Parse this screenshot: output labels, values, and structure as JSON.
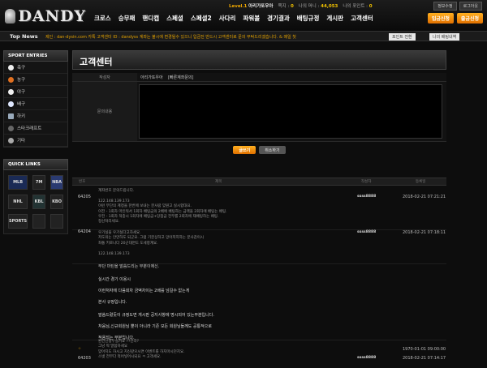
{
  "header": {
    "logo_text": "DANDY",
    "level": "Level.1",
    "username": "아리가또우아",
    "stat1_label": "쪽지 :",
    "stat1_value": "0",
    "money_label": "나의 머니 :",
    "money_value": "44,053",
    "point_label": "나의 포인트 :",
    "point_value": "0",
    "links": [
      "정보수정",
      "로그아웃"
    ],
    "nav": [
      "크로스",
      "승무패",
      "핸디캡",
      "스페셜",
      "스페셜2",
      "사다리",
      "파워볼",
      "경기결과",
      "배팅규정",
      "게시판",
      "고객센터"
    ],
    "deposit_button": "입금신청",
    "withdraw_button": "출금신청"
  },
  "ticker": {
    "label": "Top News",
    "message": "제인 : dan-dysin.com 카톡 고객센터 ID : dandyss 계좌는 불시에 변경될수 있으니 입금전 반드시 고객센터로 문의 부탁드리겠습니다. & 매일 첫",
    "btn1": "포인트 전환",
    "btn2": "나의 배팅내역"
  },
  "sidebar": {
    "sport_title": "SPORT ENTRIES",
    "sports": [
      "축구",
      "농구",
      "야구",
      "배구",
      "하키",
      "스타크래프트",
      "기타"
    ],
    "quick_title": "QUICK LINKS",
    "quick": [
      "MLB",
      "7M",
      "NBA",
      "NHL",
      "KBL",
      "KBO",
      "SPORTS",
      "",
      ""
    ]
  },
  "main": {
    "title": "고객센터",
    "author_label": "작성자",
    "author_value": "아리가또우아",
    "subject_prefix": "[빠른계좌문의]",
    "content_label": "문의내용",
    "write_button": "글쓰기",
    "cancel_button": "취소하기",
    "columns": [
      "번호",
      "제목",
      "작성자",
      "등록일"
    ],
    "rows": [
      {
        "no": "64205",
        "author": "ssss8888",
        "date": "2018-02-21 07:21:21",
        "lines": [
          "계좌번호 문의드립니다.",
          "",
          "122.148.139.173",
          "이런 무단의 계정을 한번에 보내는 분사람 맞원고 실시합대요.",
          "이전 - 1회차 마인워서 1회차 배팅금의 2배에 배팅하는 금액을 2회차에 배팅는 배팅.",
          "우전 - 1회차 적중시 1회차에 배팅금+당첨금 전부를 2회차에 재배팅하는 배팅.",
          "정산처리세요."
        ]
      },
      {
        "no": "64204",
        "author": "ssss8888",
        "date": "2018-02-21 07:18:11",
        "lines": [
          "우기실을 우기실다고하세요.",
          "저도의는 안만하도 되군요. 그럼 기분상하고 망아저지하는 분사감이시",
          "좌통 키로니다 20군대면도 도세항계요.",
          "",
          "122.148.139.173"
        ]
      },
      {
        "no": "",
        "author": "",
        "date": "1970-01-01 09:00:00",
        "badge": "",
        "lines": [
          "무단 마틴을 말씀드리는 부분이에신.",
          "실시간 경기 이용시",
          "이런처자에 다음회차 금액차이는 2배를 넘길수 없는게",
          "본사 규정입니다.",
          "말씀드렸듯이 규정도면 게시판 공지사항에 명시되어 있는부분입니다.",
          "처음님,신규회원님 뿐이 아니라 기존 모든 회원님들께도 공통적으로",
          "적용되는 부분입니다."
        ]
      },
      {
        "no": "64203",
        "author": "ssss8888",
        "date": "2018-02-21 07:14:17",
        "lines": [
          "환전신청두실거요 ??인라?",
          "그냥 딱 말씀하세요",
          "맞아지도 하시고 지신같으시면 이벤트를 하지마시던지요.",
          "스벗 전부다 적어넣어시되요 ㅋ 고객세요."
        ]
      }
    ]
  }
}
